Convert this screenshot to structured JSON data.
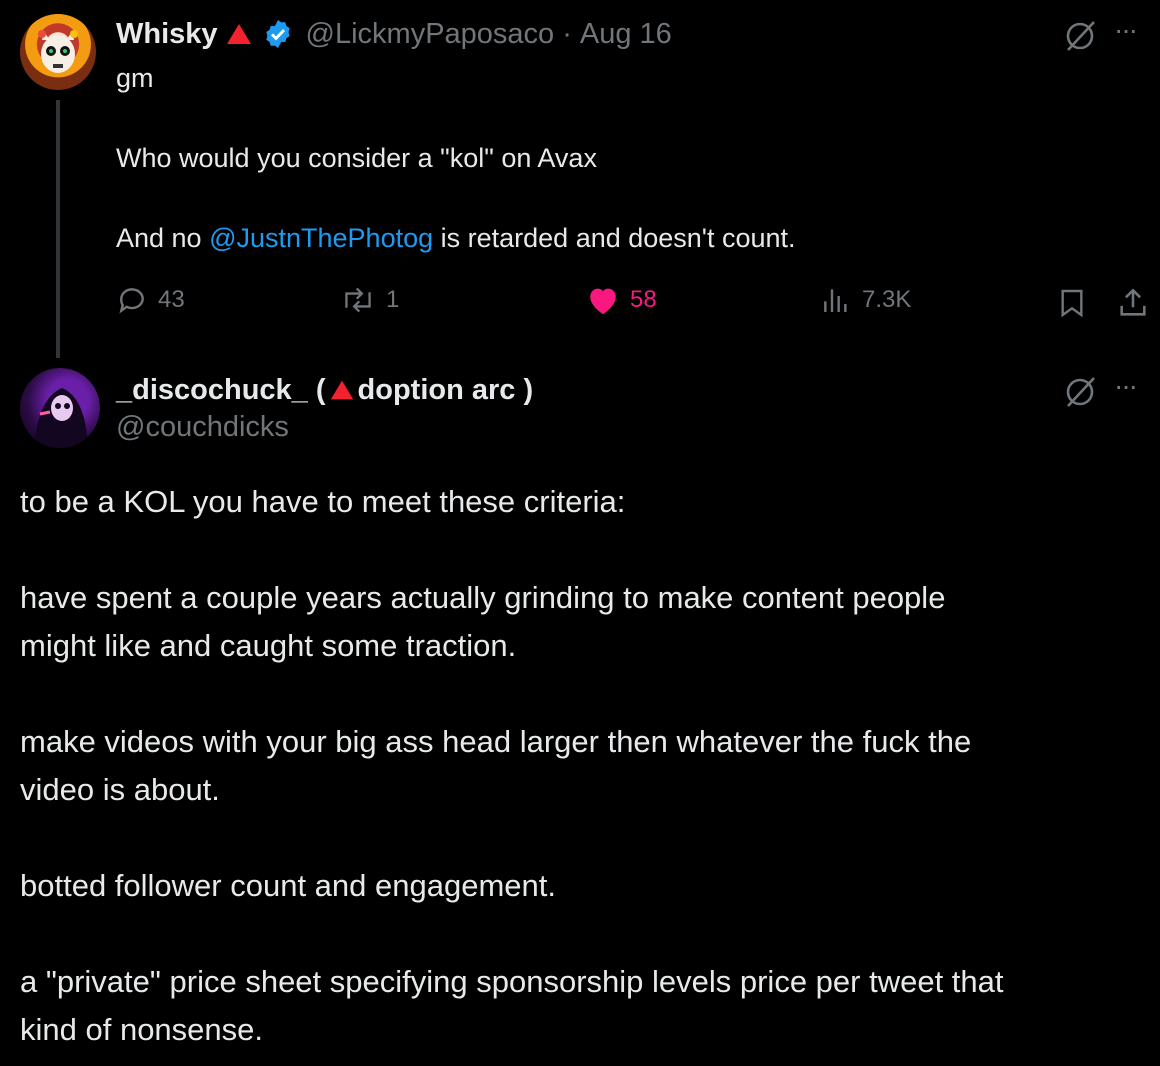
{
  "tweet1": {
    "display_name": "Whisky",
    "handle": "@LickmyPaposaco",
    "separator": "·",
    "date": "Aug 16",
    "line1": "gm",
    "line2": "Who would you consider a \"kol\" on Avax",
    "line3_prefix": "And no ",
    "line3_mention": "@JustnThePhotog",
    "line3_suffix": " is retarded and doesn't count.",
    "replies": "43",
    "reposts": "1",
    "likes": "58",
    "views": "7.3K",
    "like_color": "#f91880"
  },
  "tweet2": {
    "display_name_prefix": "_discochuck_ ( ",
    "display_name_suffix": " doption arc )",
    "handle": "@couchdicks",
    "paragraphs": [
      "to be a KOL you have to meet these criteria:",
      "have spent a couple years actually grinding to make content people",
      "might like and caught some traction.",
      "make videos with your big ass head larger then whatever the fuck the",
      "video is about.",
      "botted follower count and engagement.",
      "a \"private\" price sheet specifying sponsorship levels price per tweet that",
      "kind of nonsense."
    ]
  },
  "icons": {
    "triangle_color": "#f4212e",
    "verified_color": "#1d9bf0",
    "more": "more-icon",
    "grok": "grok-icon"
  },
  "more_label": "···"
}
